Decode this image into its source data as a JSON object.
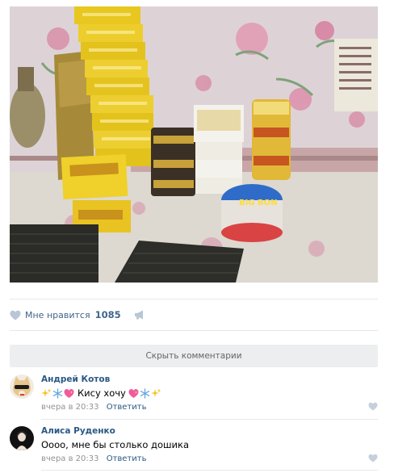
{
  "post": {
    "photo_alt": "",
    "likes": {
      "label": "Мне нравится",
      "count": "1085"
    },
    "hide_comments_label": "Скрыть комментарии"
  },
  "comments": [
    {
      "author": "Андрей Котов",
      "text": "Кису хочу",
      "date": "вчера в 20:33",
      "reply_label": "Ответить"
    },
    {
      "author": "Алиса Руденко",
      "text": "Оооо, мне бы столько дошика",
      "date": "вчера в 20:33",
      "reply_label": "Ответить"
    }
  ],
  "colors": {
    "link": "#2a5885",
    "like_text": "#42648b",
    "muted": "#939393",
    "divider": "#e7e8ec",
    "button_bg": "#edeef0"
  },
  "icons": {
    "like": "heart-icon",
    "share": "megaphone-icon",
    "sparkles": "sparkles-emoji",
    "snowflake": "snowflake-emoji",
    "sparkle_heart": "sparkling-heart-emoji"
  }
}
